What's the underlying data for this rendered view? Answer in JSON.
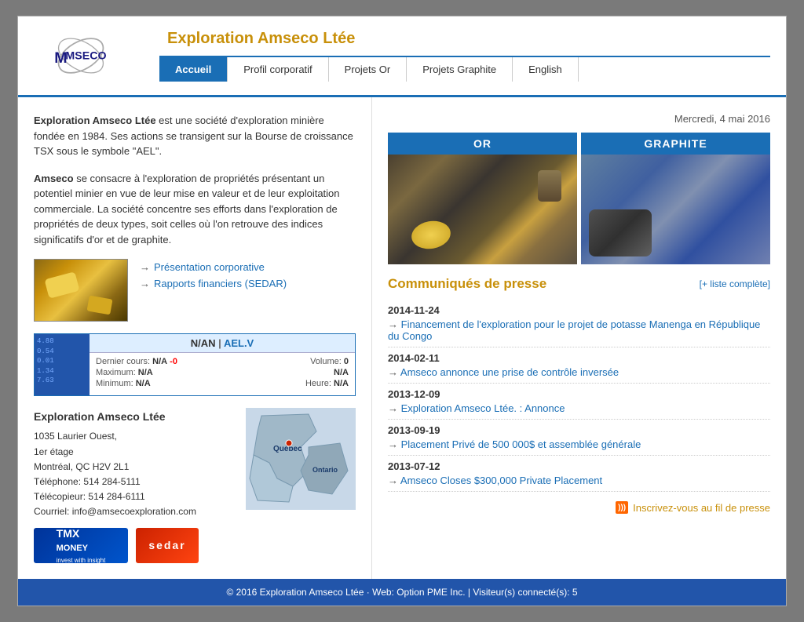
{
  "site": {
    "title": "Exploration Amseco Ltée",
    "date": "Mercredi, 4 mai 2016"
  },
  "nav": {
    "items": [
      {
        "label": "Accueil",
        "active": true
      },
      {
        "label": "Profil corporatif",
        "active": false
      },
      {
        "label": "Projets Or",
        "active": false
      },
      {
        "label": "Projets Graphite",
        "active": false
      },
      {
        "label": "English",
        "active": false
      }
    ]
  },
  "intro": {
    "para1_bold": "Exploration Amseco Ltée",
    "para1_rest": " est une société d'exploration minière fondée en 1984. Ses actions se transigent sur la Bourse de croissance TSX sous le symbole \"AEL\".",
    "para2_bold": "Amseco",
    "para2_rest": " se consacre à l'exploration de propriétés présentant un potentiel minier en vue de leur mise en valeur et de leur exploitation commerciale. La société concentre ses efforts dans l'exploration de propriétés de deux types, soit celles où l'on retrouve des indices significatifs d'or et de graphite."
  },
  "links": {
    "presentation": "Présentation corporative",
    "rapports": "Rapports financiers (SEDAR)"
  },
  "stock": {
    "title": "N/AN",
    "separator": "|",
    "symbol": "AEL.V",
    "dernier_label": "Dernier cours:",
    "dernier_value": "N/A",
    "volume_label": "Volume:",
    "volume_value": "0",
    "maximum_label": "Maximum:",
    "maximum_value": "N/A",
    "max_right": "N/A",
    "minimum_label": "Minimum:",
    "minimum_value": "N/A",
    "heure_label": "Heure:",
    "heure_value": "N/A",
    "chart_lines": [
      "4.88",
      "0.54",
      "0.01",
      "1.34",
      "7.63"
    ]
  },
  "contact": {
    "company": "Exploration Amseco Ltée",
    "address1": "1035 Laurier Ouest,",
    "address2": "1er étage",
    "city": "Montréal, QC H2V 2L1",
    "telephone_label": "Téléphone:",
    "telephone": "514 284-5111",
    "telecopieur_label": "Télécopieur:",
    "telecopieur": "514 284-6111",
    "courriel_label": "Courriel:",
    "courriel": "info@amsecoexploration.com"
  },
  "map": {
    "quebec_label": "Québec",
    "ontario_label": "Ontario"
  },
  "projects": {
    "or_label": "OR",
    "graphite_label": "GRAPHITE"
  },
  "press": {
    "title": "Communiqués de presse",
    "list_link": "[+ liste complète]",
    "items": [
      {
        "date": "2014-11-24",
        "text": "Financement de l'exploration pour le projet de potasse Manenga en République du Congo"
      },
      {
        "date": "2014-02-11",
        "text": "Amseco annonce une prise de contrôle inversée"
      },
      {
        "date": "2013-12-09",
        "text": "Exploration Amseco Ltée. : Annonce"
      },
      {
        "date": "2013-09-19",
        "text": "Placement Privé de 500 000$ et assemblée générale"
      },
      {
        "date": "2013-07-12",
        "text": "Amseco Closes $300,000 Private Placement"
      }
    ],
    "rss_text": "Inscrivez-vous au fil de presse"
  },
  "footer": {
    "copyright": "© 2016 Exploration Amseco Ltée",
    "separator1": "·",
    "web_label": "Web: Option PME Inc.",
    "separator2": "|",
    "visitors": "Visiteur(s) connecté(s): 5"
  },
  "badges": {
    "tmx_line1": "TMX",
    "tmx_line2": "MONEY",
    "tmx_tagline": "invest with insight",
    "sedar": "sedar"
  }
}
